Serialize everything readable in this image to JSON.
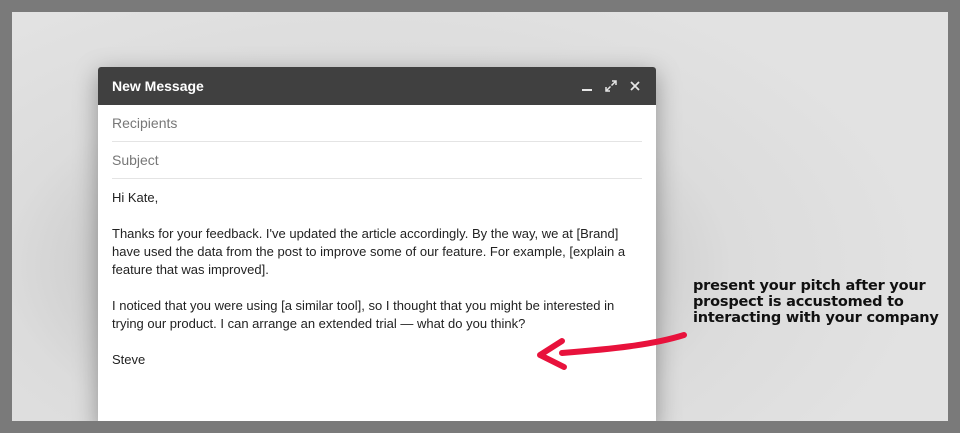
{
  "window": {
    "title": "New Message"
  },
  "controls": {
    "minimize_icon": "minimize-icon",
    "expand_icon": "expand-icon",
    "close_icon": "close-icon"
  },
  "fields": {
    "recipients_placeholder": "Recipients",
    "subject_placeholder": "Subject"
  },
  "message": {
    "greeting": "Hi Kate,",
    "paragraph1": "Thanks for your feedback. I've updated the article accordingly. By the way, we at [Brand] have used the data from the post to improve some of our feature. For example, [explain a feature that was improved].",
    "paragraph2": "I noticed that you were using [a similar tool], so I thought that you might be interested in trying our product. I can arrange an extended trial — what do you think?",
    "signature": "Steve"
  },
  "annotation": {
    "line1": "present your pitch after your",
    "line2": "prospect is accustomed to",
    "line3": "interacting with your company",
    "arrow_color": "#e8123c"
  }
}
